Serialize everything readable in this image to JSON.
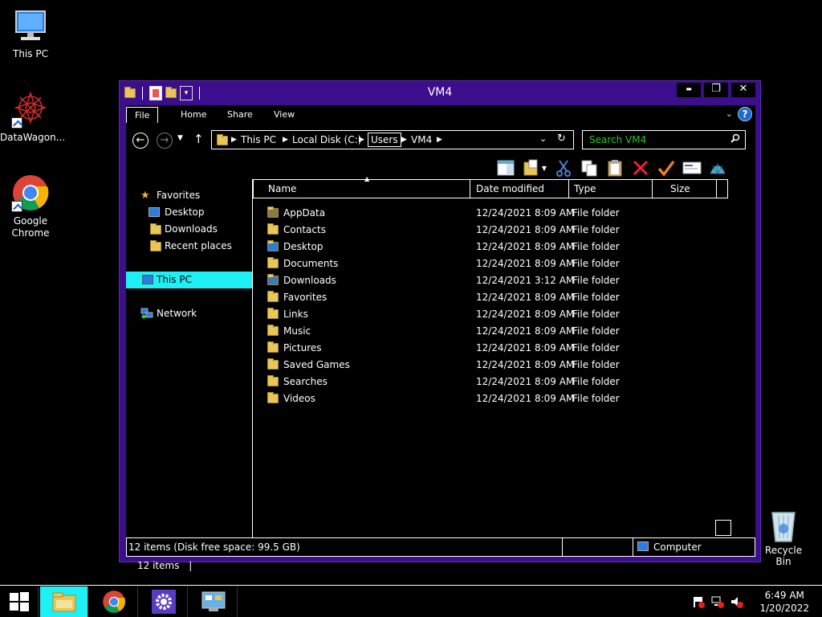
{
  "desktop": {
    "icons": [
      {
        "label": "This PC"
      },
      {
        "label": "DataWagon..."
      },
      {
        "label": "Google\nChrome"
      },
      {
        "label": "Recycle Bin"
      }
    ]
  },
  "window": {
    "title": "VM4",
    "controls": {
      "minimize": "▬",
      "maximize": "❐",
      "close": "✕"
    },
    "ribbon_tabs": [
      "File",
      "Home",
      "Share",
      "View"
    ],
    "address": {
      "crumbs": [
        "This PC",
        "Local Disk (C:)",
        "Users",
        "VM4"
      ]
    },
    "search": {
      "placeholder": "Search VM4"
    },
    "nav_pane": {
      "favorites": "Favorites",
      "favorites_items": [
        "Desktop",
        "Downloads",
        "Recent places"
      ],
      "this_pc": "This PC",
      "network": "Network"
    },
    "columns": [
      "Name",
      "Date modified",
      "Type",
      "Size"
    ],
    "files": [
      {
        "name": "AppData",
        "date": "12/24/2021 8:09 AM",
        "type": "File folder"
      },
      {
        "name": "Contacts",
        "date": "12/24/2021 8:09 AM",
        "type": "File folder"
      },
      {
        "name": "Desktop",
        "date": "12/24/2021 8:09 AM",
        "type": "File folder"
      },
      {
        "name": "Documents",
        "date": "12/24/2021 8:09 AM",
        "type": "File folder"
      },
      {
        "name": "Downloads",
        "date": "12/24/2021 3:12 AM",
        "type": "File folder"
      },
      {
        "name": "Favorites",
        "date": "12/24/2021 8:09 AM",
        "type": "File folder"
      },
      {
        "name": "Links",
        "date": "12/24/2021 8:09 AM",
        "type": "File folder"
      },
      {
        "name": "Music",
        "date": "12/24/2021 8:09 AM",
        "type": "File folder"
      },
      {
        "name": "Pictures",
        "date": "12/24/2021 8:09 AM",
        "type": "File folder"
      },
      {
        "name": "Saved Games",
        "date": "12/24/2021 8:09 AM",
        "type": "File folder"
      },
      {
        "name": "Searches",
        "date": "12/24/2021 8:09 AM",
        "type": "File folder"
      },
      {
        "name": "Videos",
        "date": "12/24/2021 8:09 AM",
        "type": "File folder"
      }
    ],
    "item_count": "12 items",
    "status": {
      "left": "12 items (Disk free space: 99.5 GB)",
      "right": "Computer"
    }
  },
  "taskbar": {
    "time": "6:49 AM",
    "date": "1/20/2022"
  },
  "colors": {
    "titlebar": "#3c0d8c",
    "selection": "#1ef0f6",
    "search_placeholder": "#2cc22c"
  }
}
